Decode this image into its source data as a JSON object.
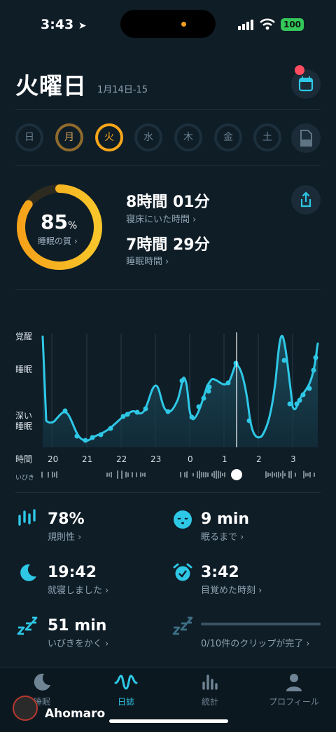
{
  "status_bar": {
    "time": "3:43",
    "battery": "100"
  },
  "header": {
    "title": "火曜日",
    "date_range": "1月14日-15"
  },
  "days": [
    {
      "label": "日",
      "state": "empty"
    },
    {
      "label": "月",
      "state": "done"
    },
    {
      "label": "火",
      "state": "active"
    },
    {
      "label": "水",
      "state": "empty"
    },
    {
      "label": "木",
      "state": "empty"
    },
    {
      "label": "金",
      "state": "empty"
    },
    {
      "label": "土",
      "state": "empty"
    }
  ],
  "summary": {
    "quality_value": "85",
    "quality_unit": "%",
    "quality_fraction": 0.85,
    "quality_label": "睡眠の質 ›",
    "in_bed_value": "8時間 01分",
    "in_bed_label": "寝床にいた時間 ›",
    "asleep_value": "7時間 29分",
    "asleep_label": "睡眠時間 ›"
  },
  "chart": {
    "y_labels": [
      "覚醒",
      "睡眠",
      "深い\n睡眠"
    ],
    "x_title": "時間",
    "hours": [
      "20",
      "21",
      "22",
      "23",
      "0",
      "1",
      "2",
      "3"
    ],
    "snore_label": "いびき",
    "accent": "#2ec8e6"
  },
  "stats": {
    "regularity_value": "78%",
    "regularity_label": "規則性 ›",
    "fall_asleep_value": "9 min",
    "fall_asleep_label": "眠るまで ›",
    "bedtime_value": "19:42",
    "bedtime_label": "就寝しました ›",
    "wake_value": "3:42",
    "wake_label": "目覚めた時刻 ›",
    "snoring_value": "51 min",
    "snoring_label": "いびきをかく ›",
    "clips_label": "0/10件のクリップが完了 ›"
  },
  "nav": {
    "items": [
      "睡眠",
      "日誌",
      "統計",
      "プロフィール"
    ],
    "active_index": 1
  },
  "watermark": {
    "name": "Ahomaro"
  }
}
